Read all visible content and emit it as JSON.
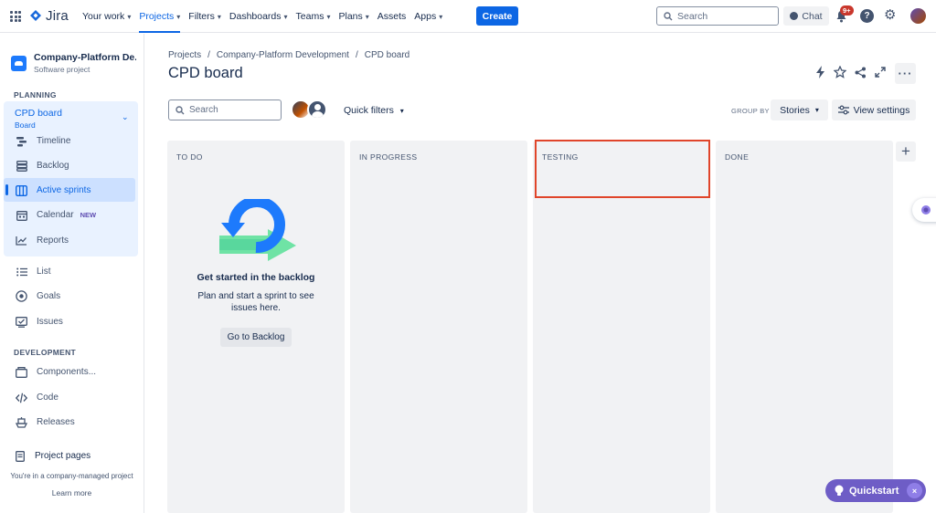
{
  "topnav": {
    "logo": "Jira",
    "items": [
      {
        "label": "Your work",
        "chevron": true
      },
      {
        "label": "Projects",
        "chevron": true,
        "active": true
      },
      {
        "label": "Filters",
        "chevron": true
      },
      {
        "label": "Dashboards",
        "chevron": true
      },
      {
        "label": "Teams",
        "chevron": true
      },
      {
        "label": "Plans",
        "chevron": true
      },
      {
        "label": "Assets",
        "chevron": false
      },
      {
        "label": "Apps",
        "chevron": true
      }
    ],
    "create_label": "Create",
    "search_placeholder": "Search",
    "chat_label": "Chat",
    "notifications_badge": "9+",
    "help_glyph": "?",
    "accent_color": "#0c66e4"
  },
  "sidebar": {
    "project_name": "Company-Platform De...",
    "project_type": "Software project",
    "planning_heading": "PLANNING",
    "board_title": "CPD board",
    "board_sub": "Board",
    "planning_items": [
      {
        "label": "Timeline",
        "icon": "timeline-icon"
      },
      {
        "label": "Backlog",
        "icon": "backlog-icon"
      },
      {
        "label": "Active sprints",
        "icon": "board-columns-icon",
        "active": true
      },
      {
        "label": "Calendar",
        "icon": "calendar-icon",
        "lozenge": "NEW"
      },
      {
        "label": "Reports",
        "icon": "chart-icon"
      }
    ],
    "other_items": [
      {
        "label": "List",
        "icon": "list-icon"
      },
      {
        "label": "Goals",
        "icon": "target-icon"
      },
      {
        "label": "Issues",
        "icon": "issues-icon"
      }
    ],
    "development_heading": "DEVELOPMENT",
    "development_items": [
      {
        "label": "Components...",
        "icon": "components-icon"
      },
      {
        "label": "Code",
        "icon": "code-icon"
      },
      {
        "label": "Releases",
        "icon": "ship-icon"
      }
    ],
    "project_pages": "Project pages",
    "managed_text": "You're in a company-managed project",
    "learn_more": "Learn more"
  },
  "main": {
    "breadcrumbs": [
      "Projects",
      "Company-Platform Development",
      "CPD board"
    ],
    "title": "CPD board",
    "search_placeholder": "Search",
    "quick_filters": "Quick filters",
    "group_by_label": "GROUP BY",
    "group_by_value": "Stories",
    "view_settings": "View settings",
    "columns": [
      "TO DO",
      "IN PROGRESS",
      "TESTING",
      "DONE"
    ],
    "empty_title": "Get started in the backlog",
    "empty_text": "Plan and start a sprint to see issues here.",
    "backlog_button": "Go to Backlog",
    "highlight_color": "#e0452a"
  },
  "quickstart": {
    "label": "Quickstart",
    "close_glyph": "×"
  }
}
